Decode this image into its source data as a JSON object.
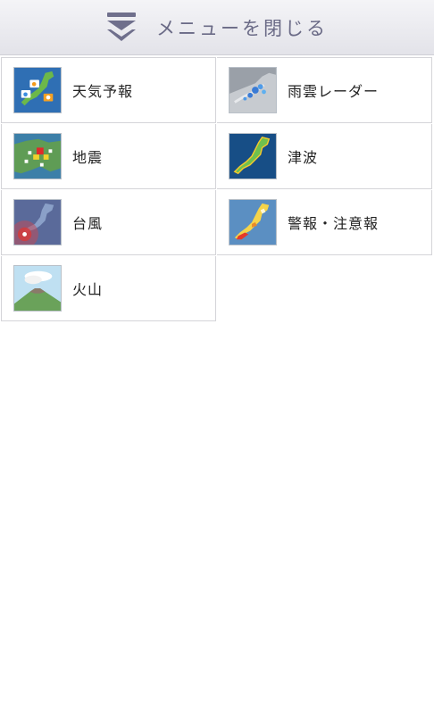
{
  "header": {
    "title": "メニューを閉じる",
    "icon": "double-chevron-down-icon"
  },
  "menu": [
    {
      "id": "forecast",
      "label": "天気予報",
      "icon": "japan-forecast-map"
    },
    {
      "id": "radar",
      "label": "雨雲レーダー",
      "icon": "rain-radar-map"
    },
    {
      "id": "earthquake",
      "label": "地震",
      "icon": "earthquake-map"
    },
    {
      "id": "tsunami",
      "label": "津波",
      "icon": "tsunami-map"
    },
    {
      "id": "typhoon",
      "label": "台風",
      "icon": "typhoon-map"
    },
    {
      "id": "warnings",
      "label": "警報・注意報",
      "icon": "warning-map"
    },
    {
      "id": "volcano",
      "label": "火山",
      "icon": "volcano-image"
    }
  ],
  "colors": {
    "header_text": "#6a6a86",
    "tile_border": "#d4d4d8",
    "label_text": "#222222"
  }
}
